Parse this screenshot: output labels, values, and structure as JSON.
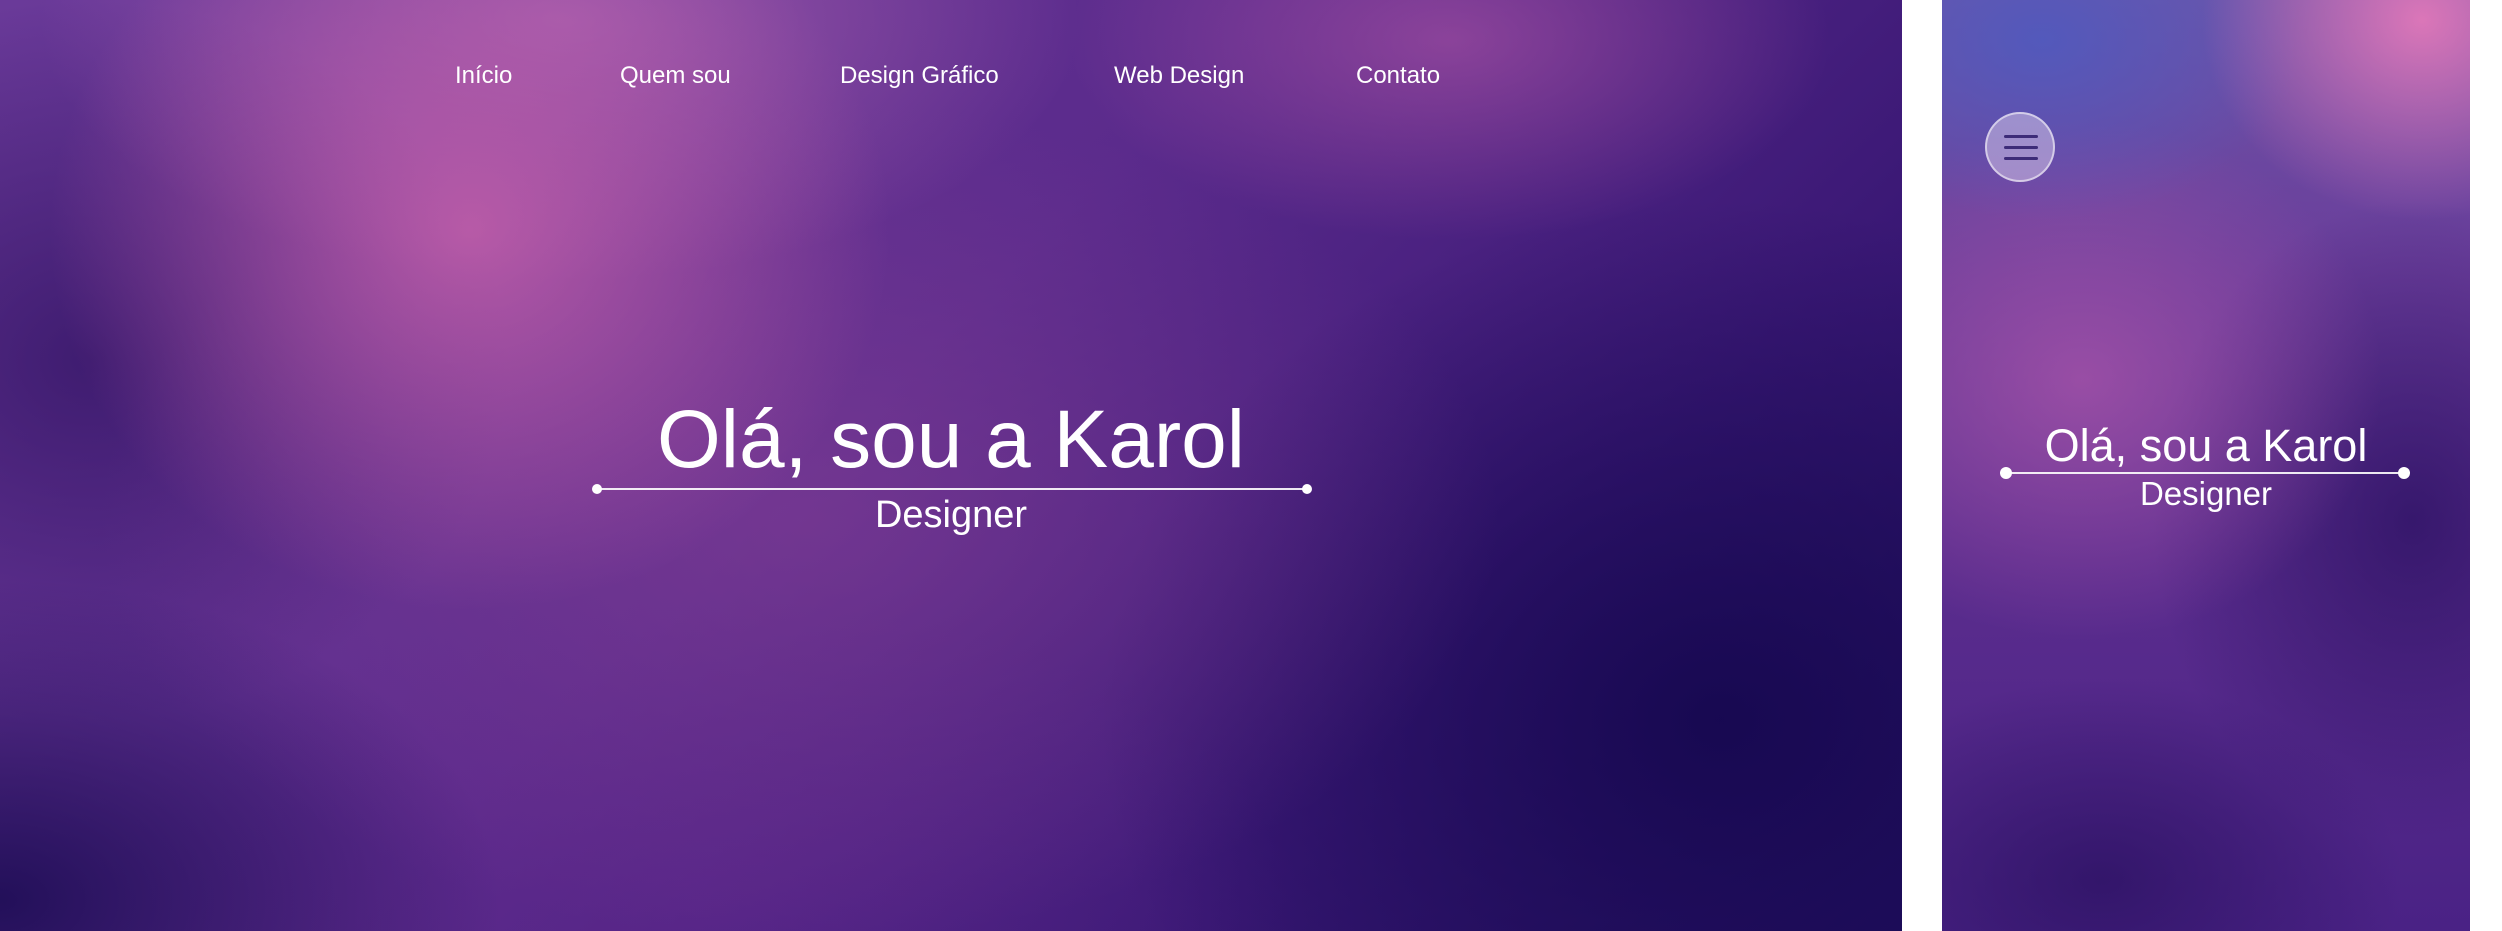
{
  "nav": {
    "items": [
      {
        "label": "Início"
      },
      {
        "label": "Quem sou"
      },
      {
        "label": "Design Gráfico"
      },
      {
        "label": "Web Design"
      },
      {
        "label": "Contato"
      }
    ]
  },
  "hero": {
    "title": "Olá, sou a Karol",
    "subtitle": "Designer"
  },
  "mobile": {
    "menu_icon": "hamburger-menu-icon",
    "title": "Olá, sou a Karol",
    "subtitle": "Designer"
  },
  "colors": {
    "text": "#ffffff",
    "menu_bars": "#3d2b78",
    "background_dark": "#22105f",
    "background_mid": "#5b2b8c",
    "background_highlight": "#c460aa"
  }
}
